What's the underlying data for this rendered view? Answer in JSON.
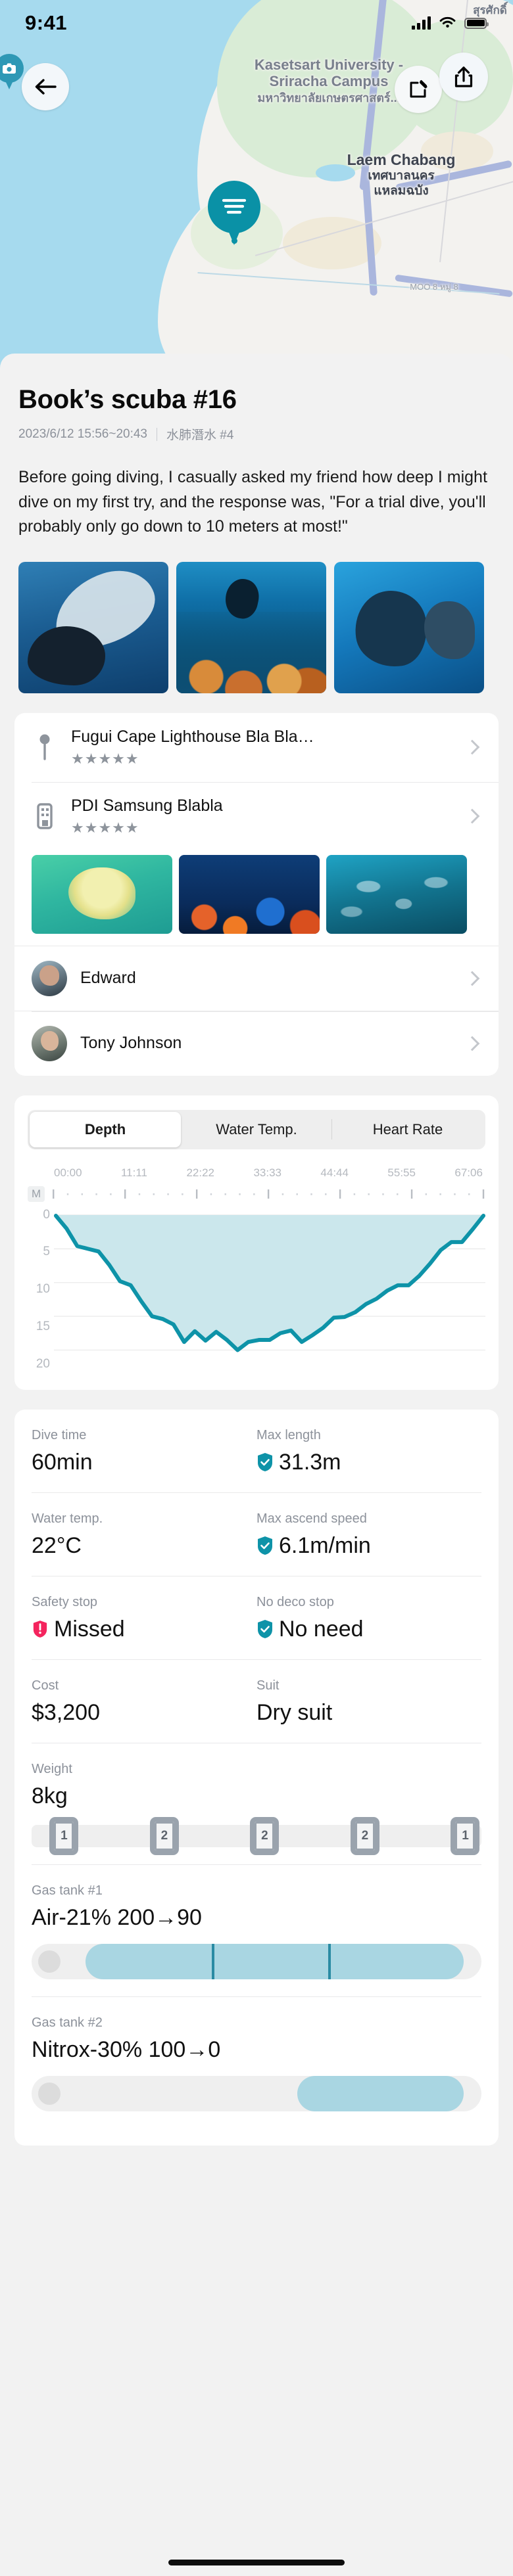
{
  "status_bar": {
    "time": "9:41",
    "signal_icon": "cellular-signal-icon",
    "wifi_icon": "wifi-icon",
    "battery_icon": "battery-icon"
  },
  "map": {
    "labels": {
      "university_en": "Kasetsart University - Sriracha Campus",
      "university_th": "มหาวิทยาลัยเกษตรศาสตร์...",
      "city_en": "Laem Chabang",
      "city_th_1": "เทศบาลนคร",
      "city_th_2": "แหลมฉบัง",
      "moo": "MOO 8 หมู่ 8",
      "surat": "สุรศักดิ์"
    },
    "back_icon": "back-arrow-icon",
    "edit_icon": "edit-pencil-icon",
    "share_icon": "share-icon",
    "dive_pin_icon": "dive-site-pin-icon",
    "camera_pin_icon": "camera-pin-icon"
  },
  "header": {
    "title": "Book’s scuba #16",
    "datetime": "2023/6/12 15:56~20:43",
    "category": "水肺潛水 #4"
  },
  "description": "Before going diving, I casually asked my friend how deep I might dive on my first try, and the response was, \"For a trial dive, you'll probably only go down to 10 meters at most!\"",
  "photos": [
    {
      "name": "photo-diver-dolphin"
    },
    {
      "name": "photo-coral-reef"
    },
    {
      "name": "photo-divers"
    }
  ],
  "places": [
    {
      "title": "Fugui Cape Lighthouse Bla Bla…",
      "stars": "★★★★★",
      "icon": "map-pin-icon"
    },
    {
      "title": "PDI Samsung Blabla",
      "stars": "★★★★★",
      "icon": "dive-center-icon"
    }
  ],
  "place_thumbs": [
    {
      "name": "thumb-jellyfish"
    },
    {
      "name": "thumb-coral-night"
    },
    {
      "name": "thumb-fish-school"
    }
  ],
  "buddies": [
    {
      "name": "Edward",
      "avatar": "avatar-edward"
    },
    {
      "name": "Tony Johnson",
      "avatar": "avatar-tony"
    }
  ],
  "chart_tabs": [
    {
      "label": "Depth",
      "active": true
    },
    {
      "label": "Water Temp.",
      "active": false
    },
    {
      "label": "Heart Rate",
      "active": false
    }
  ],
  "chart_data": {
    "type": "area",
    "title": "Depth",
    "xlabel": "",
    "ylabel": "M",
    "unit_badge": "M",
    "x_ticklabels": [
      "00:00",
      "11:11",
      "22:22",
      "33:33",
      "44:44",
      "55:55",
      "67:06"
    ],
    "y_ticklabels": [
      "0",
      "5",
      "10",
      "15",
      "20"
    ],
    "ylim": [
      0,
      22
    ],
    "y_inverted": true,
    "grid": true,
    "legend": "none",
    "line_color": "#0e93a8",
    "fill_color": "#cbe7ec",
    "x": [
      0,
      1,
      2,
      3,
      4,
      5,
      6,
      7,
      8,
      9,
      10,
      11,
      12,
      13,
      14,
      15,
      16,
      17,
      18,
      19,
      20,
      21,
      22,
      23,
      24,
      25,
      26,
      27,
      28,
      29,
      30,
      31,
      32,
      33,
      34,
      35,
      36,
      37,
      38,
      39,
      40
    ],
    "values": [
      0.1,
      2.0,
      4.6,
      5.0,
      5.4,
      7.4,
      9.8,
      10.4,
      12.8,
      15.0,
      15.4,
      16.2,
      18.8,
      17.2,
      18.6,
      17.3,
      18.5,
      20.0,
      18.8,
      18.5,
      18.5,
      17.5,
      17.1,
      18.8,
      17.8,
      16.7,
      15.2,
      15.1,
      14.4,
      13.2,
      12.4,
      11.2,
      10.4,
      10.4,
      9.0,
      7.2,
      5.2,
      4.0,
      4.0,
      2.1,
      0.1
    ]
  },
  "stats": [
    {
      "label": "Dive time",
      "value": "60min",
      "badge": "none"
    },
    {
      "label": "Max length",
      "value": "31.3m",
      "badge": "check"
    },
    {
      "label": "Water temp.",
      "value": "22°C",
      "badge": "none"
    },
    {
      "label": "Max ascend speed",
      "value": "6.1m/min",
      "badge": "check"
    },
    {
      "label": "Safety stop",
      "value": "Missed",
      "badge": "alert"
    },
    {
      "label": "No deco stop",
      "value": "No need",
      "badge": "check"
    },
    {
      "label": "Cost",
      "value": "$3,200",
      "badge": "none"
    },
    {
      "label": "Suit",
      "value": "Dry suit",
      "badge": "none"
    }
  ],
  "weight": {
    "label": "Weight",
    "value": "8kg",
    "chips": [
      "1",
      "2",
      "2",
      "2",
      "1"
    ]
  },
  "gas_tanks": [
    {
      "label": "Gas tank #1",
      "value": "Air-21% 200→90",
      "fill_start_pct": 12,
      "fill_end_pct": 96,
      "marks_pct": [
        40,
        66
      ]
    },
    {
      "label": "Gas tank #2",
      "value": "Nitrox-30% 100→0",
      "fill_start_pct": 59,
      "fill_end_pct": 96,
      "marks_pct": []
    }
  ],
  "colors": {
    "accent": "#0e93a8",
    "fill": "#cbe7ec",
    "alert": "#f4245e",
    "map_water": "#a6daee",
    "background": "#f2f2f2"
  },
  "home_indicator": "home-indicator"
}
